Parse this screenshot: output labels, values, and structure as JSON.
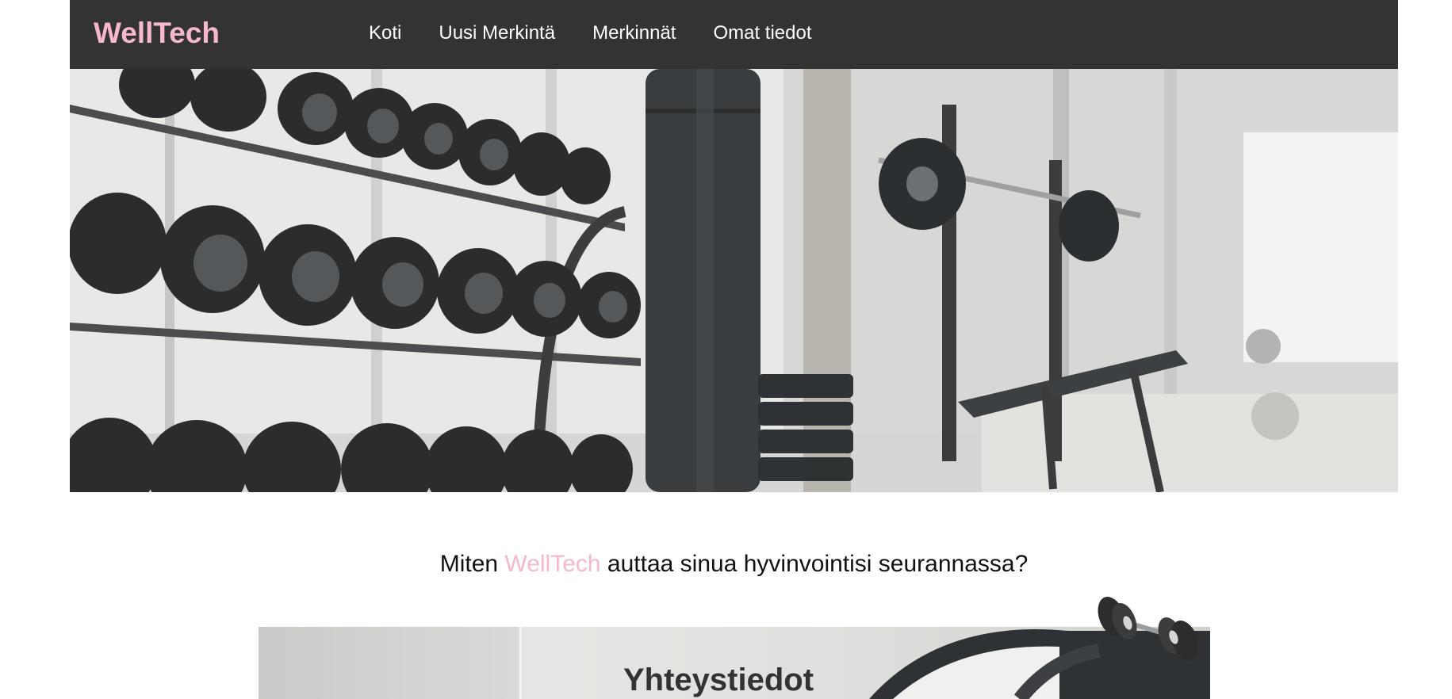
{
  "header": {
    "brand": "WellTech",
    "nav": [
      {
        "label": "Koti"
      },
      {
        "label": "Uusi Merkintä"
      },
      {
        "label": "Merkinnät"
      },
      {
        "label": "Omat tiedot"
      }
    ]
  },
  "hero": {
    "image": "gym-dumbbell-rack-photo"
  },
  "intro": {
    "prefix": "Miten ",
    "brand": "WellTech",
    "suffix": " auttaa sinua hyvinvointisi seurannassa?"
  },
  "card": {
    "title": "Yhteystiedot",
    "icon": "dumbbell-icon"
  },
  "colors": {
    "accent": "#f7b8cc",
    "navbar": "#333333"
  }
}
